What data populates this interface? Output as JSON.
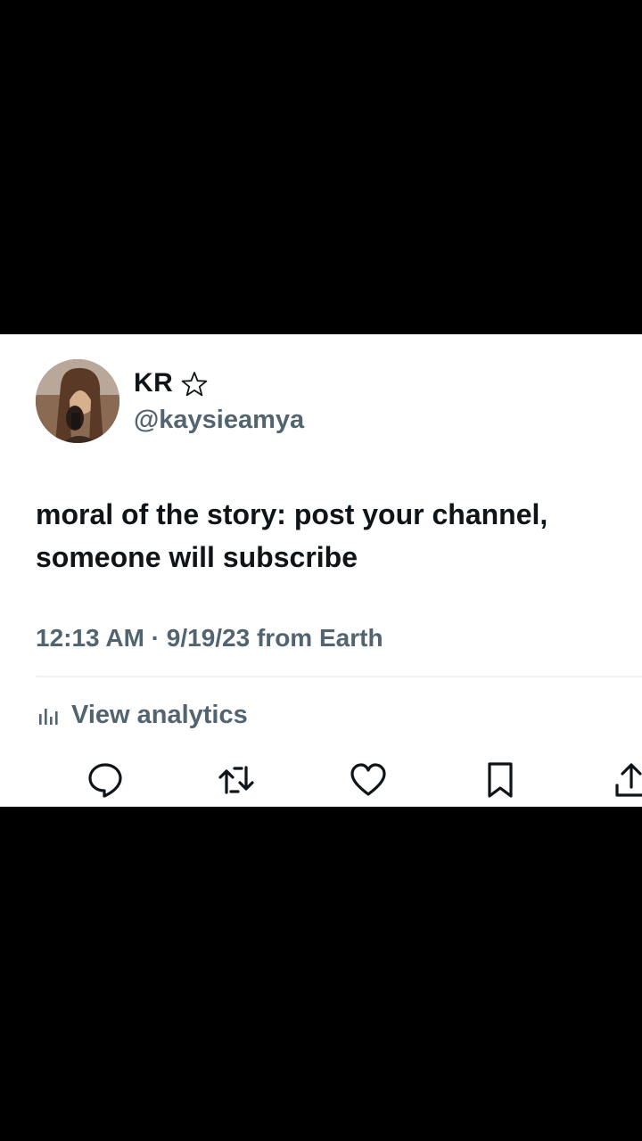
{
  "post": {
    "display_name": "KR",
    "badge_icon": "star-outline-icon",
    "handle": "@kaysieamya",
    "text": "moral of the story: post your channel,\nsomeone will subscribe",
    "timestamp": "12:13 AM · 9/19/23 from Earth",
    "analytics_label": "View analytics",
    "analytics_icon": "bar-chart-icon"
  },
  "actions": [
    {
      "name": "reply",
      "icon": "speech-bubble-icon"
    },
    {
      "name": "repost",
      "icon": "repost-arrows-icon"
    },
    {
      "name": "like",
      "icon": "heart-icon"
    },
    {
      "name": "bookmark",
      "icon": "bookmark-icon"
    },
    {
      "name": "share",
      "icon": "share-upload-icon"
    }
  ],
  "colors": {
    "primary_text": "#0f1419",
    "secondary_text": "#536471",
    "background": "#ffffff",
    "letterbox": "#000000"
  }
}
